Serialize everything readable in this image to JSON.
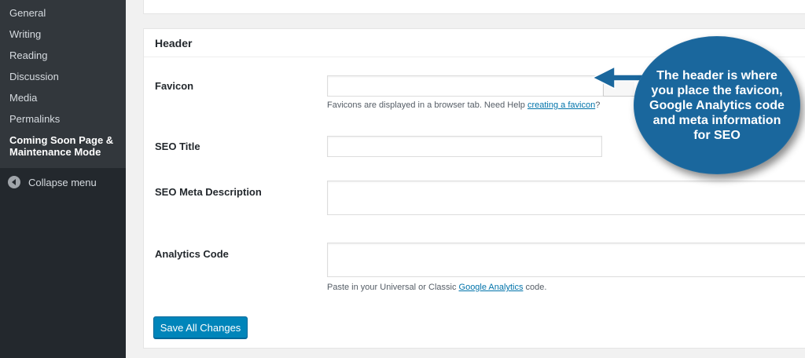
{
  "sidebar": {
    "items": [
      {
        "label": "General"
      },
      {
        "label": "Writing"
      },
      {
        "label": "Reading"
      },
      {
        "label": "Discussion"
      },
      {
        "label": "Media"
      },
      {
        "label": "Permalinks"
      },
      {
        "label": "Coming Soon Page & Maintenance Mode"
      }
    ],
    "collapse_label": "Collapse menu",
    "collapse_icon": "arrow-left-circle-icon"
  },
  "panel": {
    "title": "Header",
    "favicon": {
      "label": "Favicon",
      "value": "",
      "help_prefix": "Favicons are displayed in a browser tab. Need Help ",
      "help_link": "creating a favicon",
      "help_suffix": "?"
    },
    "seo_title": {
      "label": "SEO Title",
      "value": ""
    },
    "seo_meta": {
      "label": "SEO Meta Description",
      "value": ""
    },
    "analytics": {
      "label": "Analytics Code",
      "value": "",
      "help_prefix": "Paste in your Universal or Classic ",
      "help_link": "Google Analytics",
      "help_suffix": " code."
    },
    "save_label": "Save All Changes"
  },
  "callout": {
    "text": "The header is where you place the favicon, Google Analytics code and meta information for SEO"
  },
  "colors": {
    "sidebar_bg": "#23282d",
    "submenu_bg": "#32373c",
    "primary_button": "#0085ba",
    "link": "#0073aa",
    "callout_bg": "#1a679d"
  }
}
